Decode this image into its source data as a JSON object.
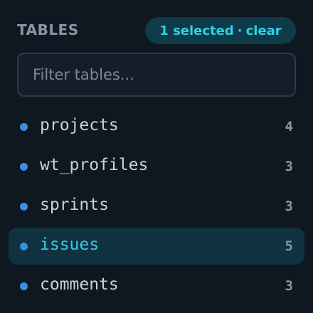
{
  "panel": {
    "title": "TABLES",
    "selection": {
      "count_label": "1 selected",
      "separator": "·",
      "clear_label": "clear"
    },
    "filter": {
      "placeholder": "Filter tables...",
      "value": ""
    },
    "tables": [
      {
        "name": "projects",
        "count": "4",
        "selected": false
      },
      {
        "name": "wt_profiles",
        "count": "3",
        "selected": false
      },
      {
        "name": "sprints",
        "count": "3",
        "selected": false
      },
      {
        "name": "issues",
        "count": "5",
        "selected": true
      },
      {
        "name": "comments",
        "count": "3",
        "selected": false
      }
    ]
  },
  "colors": {
    "background": "#0f1721",
    "accent": "#2fd0e8",
    "bullet": "#3a8fe0",
    "selected_row": "#0f3140"
  },
  "icons": {
    "row_bullet": "dot-icon"
  }
}
